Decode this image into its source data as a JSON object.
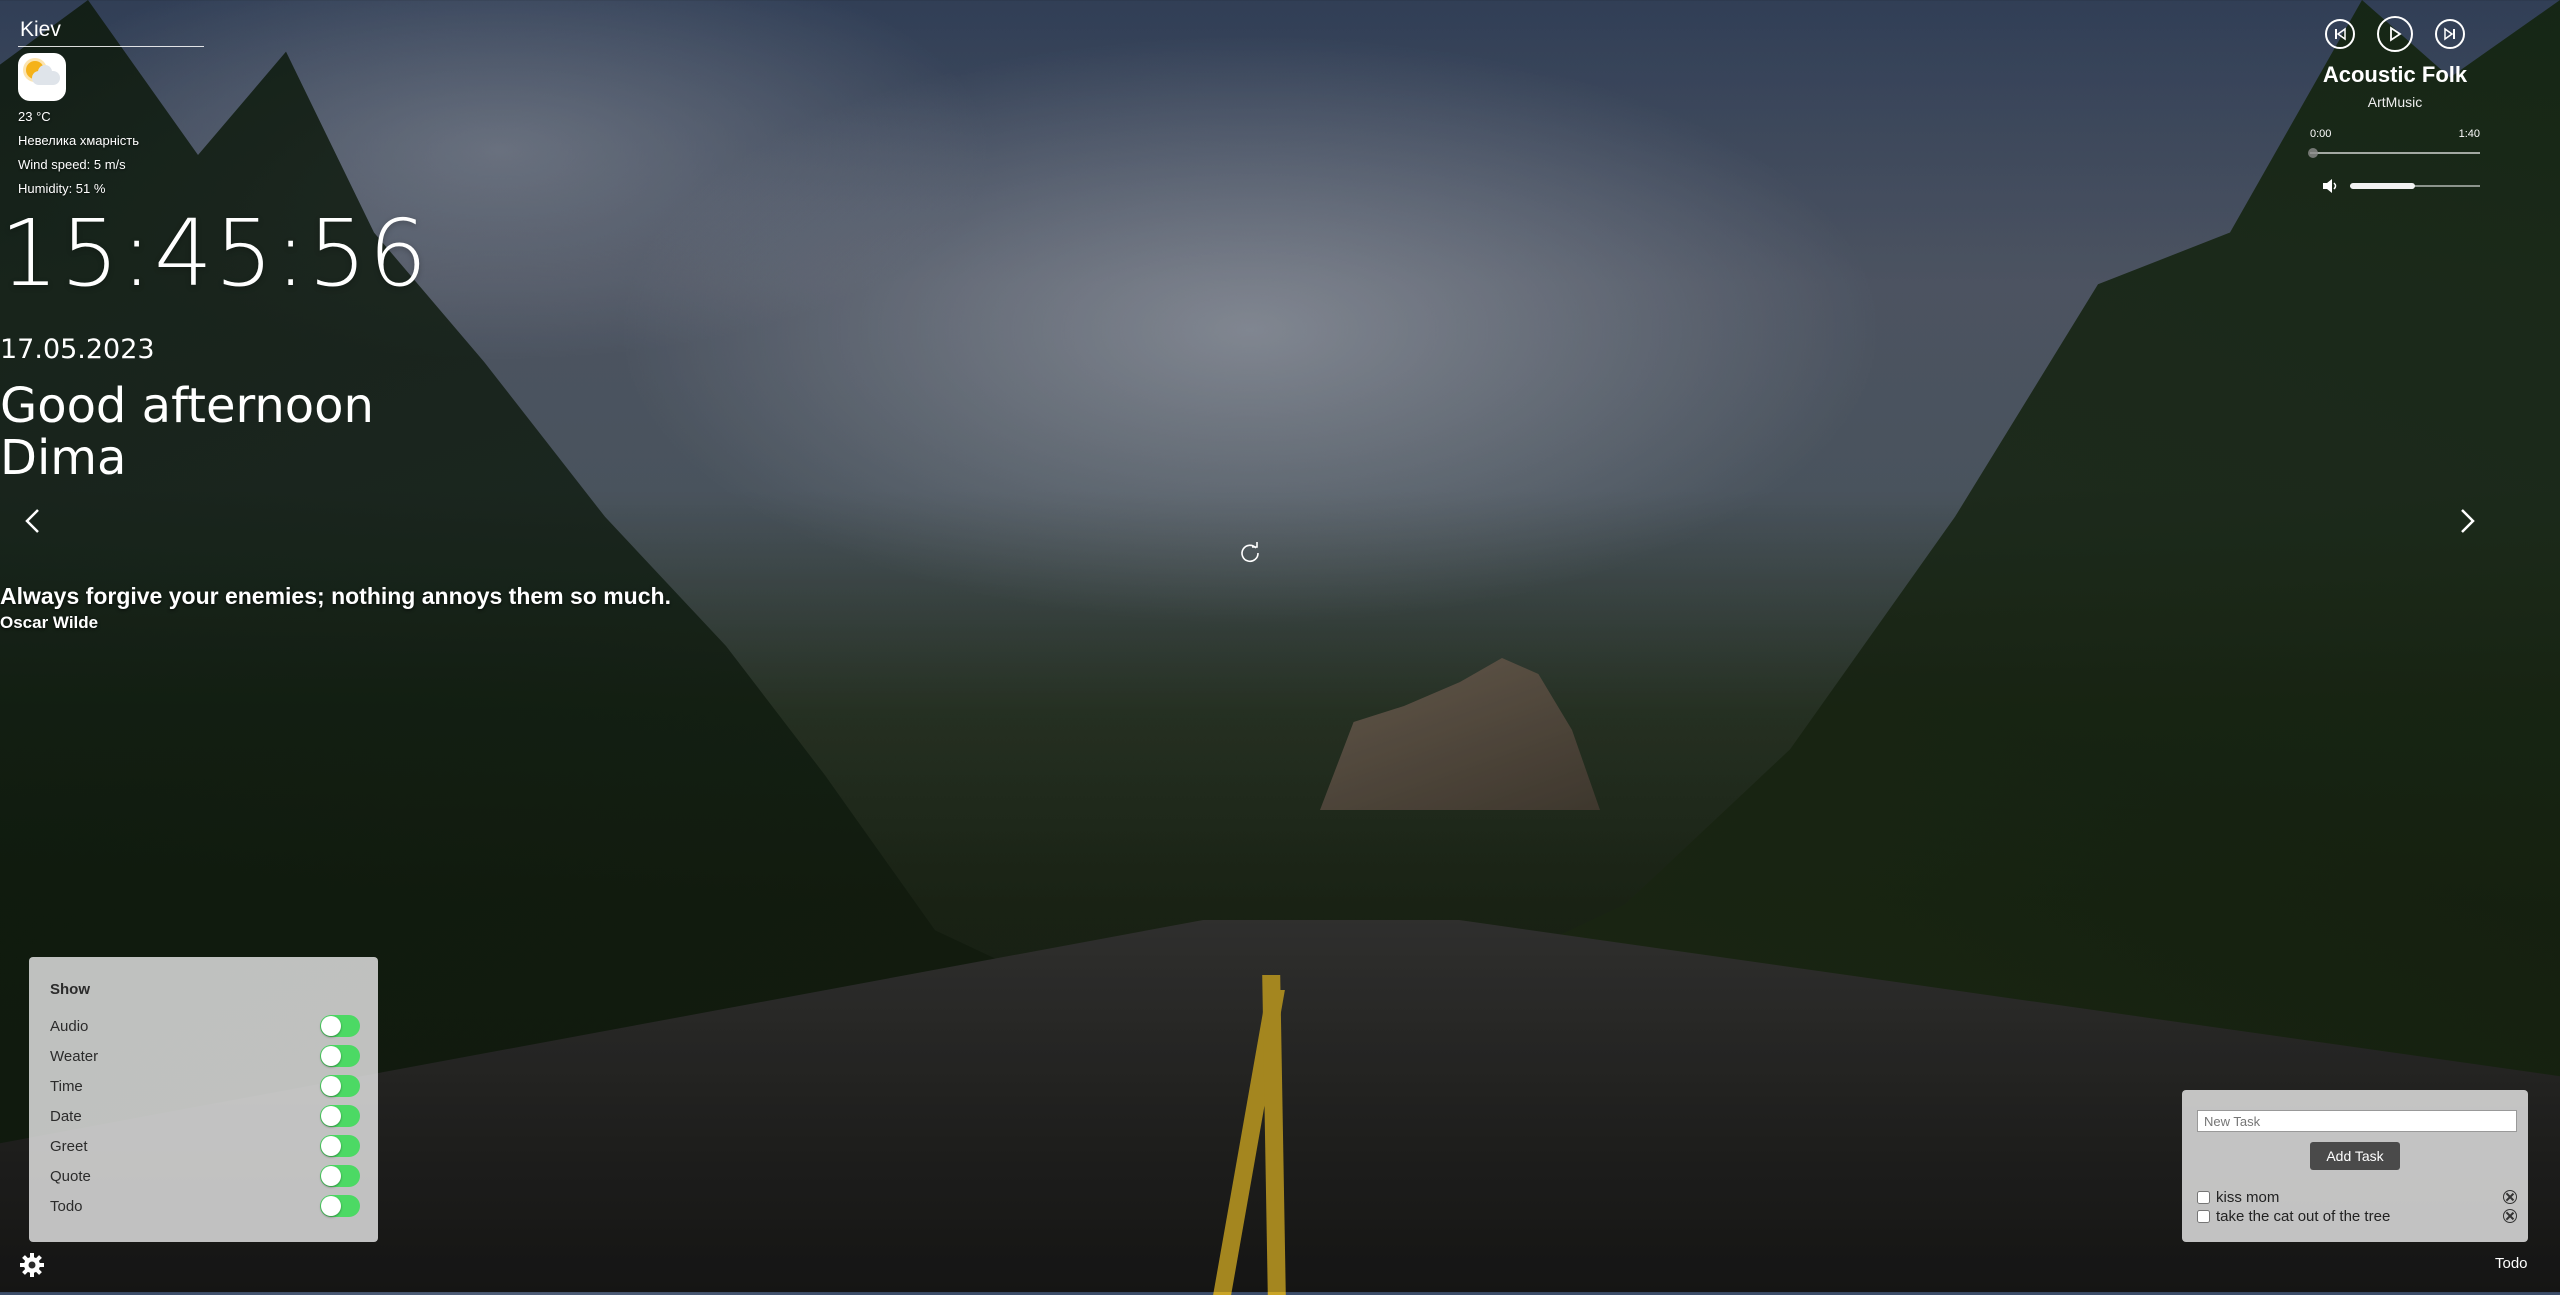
{
  "weather": {
    "city": "Kiev",
    "icon": "partly-cloudy-icon",
    "temperature": "23 °C",
    "description": "Невелика хмарність",
    "wind": "Wind speed: 5 m/s",
    "humidity": "Humidity: 51 %"
  },
  "player": {
    "title": "Acoustic Folk",
    "artist": "ArtMusic",
    "current_time": "0:00",
    "duration": "1:40",
    "progress_fraction": 0.0,
    "volume_fraction": 0.5
  },
  "clock": {
    "time": "15:45:56",
    "date": "17.05.2023"
  },
  "greeting": {
    "line1": "Good afternoon",
    "name": "Dima"
  },
  "quote": {
    "text": "Always forgive your enemies; nothing annoys them so much.",
    "author": "Oscar Wilde"
  },
  "settings": {
    "title": "Show",
    "items": [
      {
        "label": "Audio",
        "on": true
      },
      {
        "label": "Weater",
        "on": true
      },
      {
        "label": "Time",
        "on": true
      },
      {
        "label": "Date",
        "on": true
      },
      {
        "label": "Greet",
        "on": true
      },
      {
        "label": "Quote",
        "on": true
      },
      {
        "label": "Todo",
        "on": true
      }
    ]
  },
  "todo": {
    "placeholder": "New Task",
    "add_label": "Add Task",
    "tasks": [
      {
        "text": "kiss mom",
        "done": false
      },
      {
        "text": "take the cat out of the tree",
        "done": false
      }
    ],
    "toggle_label": "Todo"
  },
  "colors": {
    "toggle_on": "#4cd964",
    "button_dark": "#4a4a4a"
  }
}
